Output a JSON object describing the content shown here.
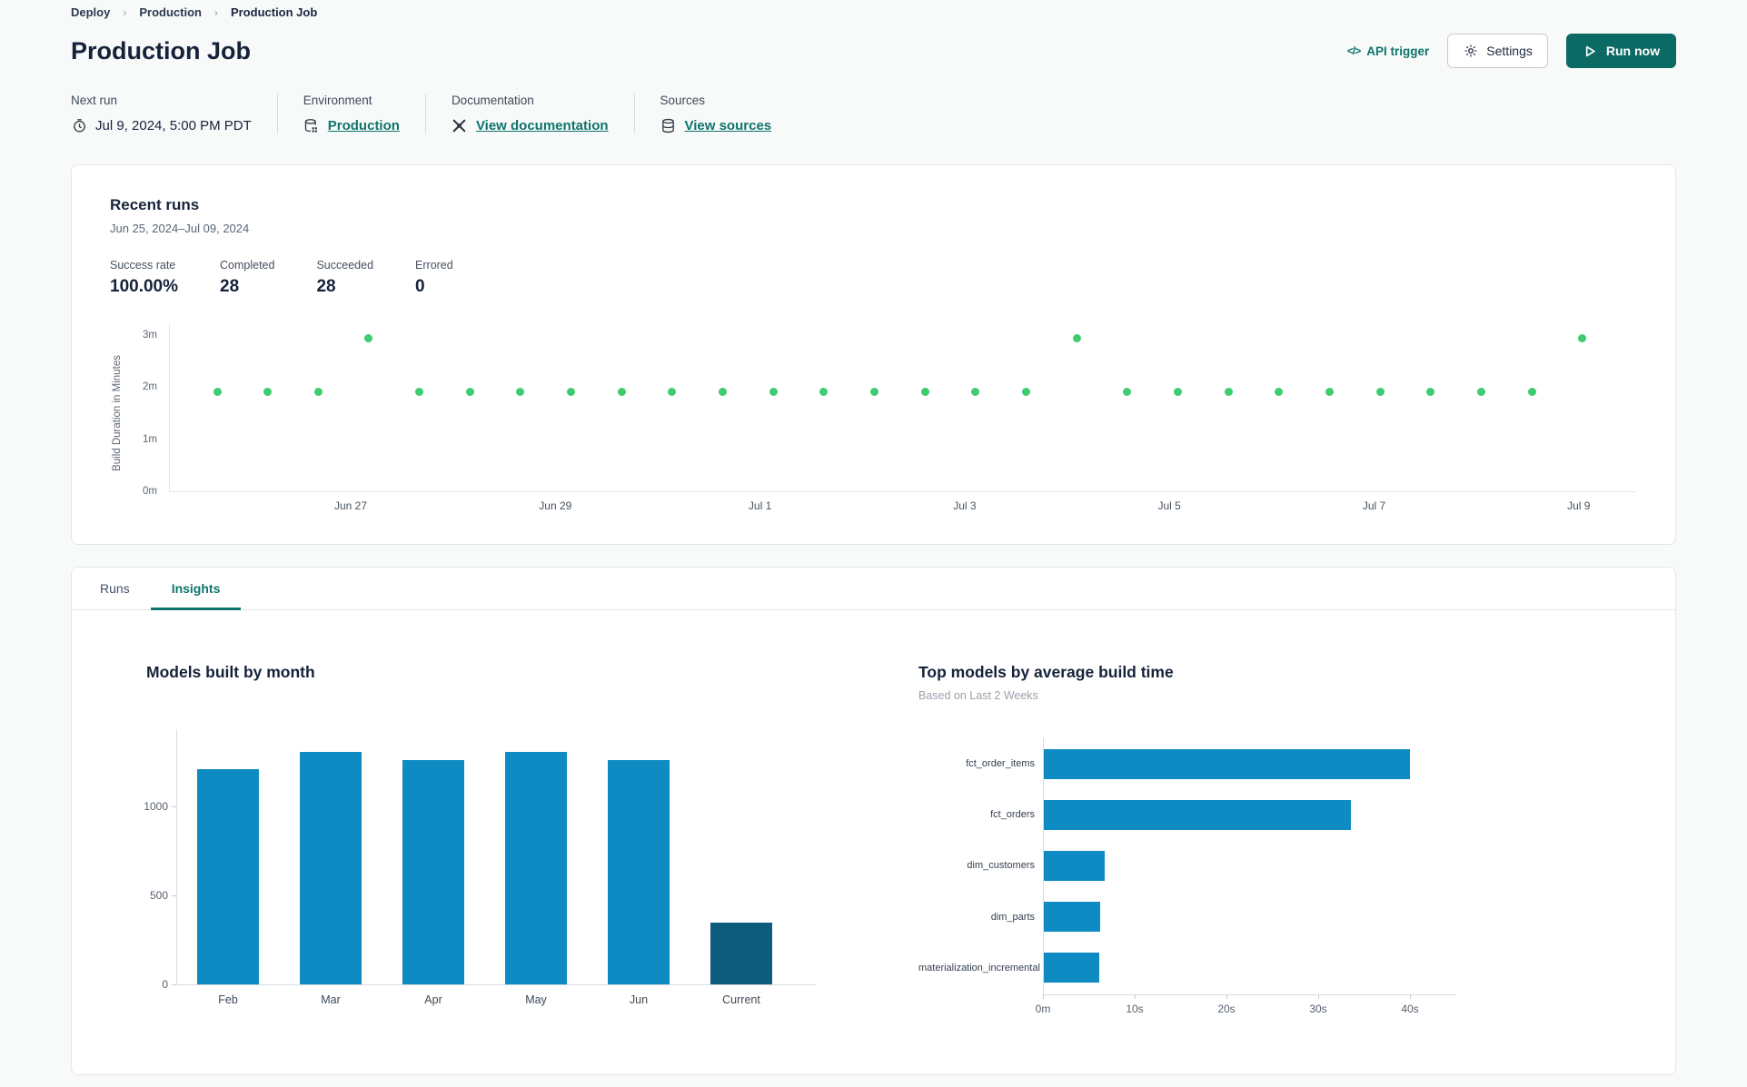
{
  "breadcrumb": {
    "items": [
      "Deploy",
      "Production",
      "Production Job"
    ]
  },
  "header": {
    "title": "Production Job",
    "api_trigger_label": "API trigger",
    "settings_label": "Settings",
    "run_now_label": "Run now"
  },
  "meta": [
    {
      "label": "Next run",
      "value": "Jul 9, 2024, 5:00 PM PDT",
      "icon": "clock-icon",
      "is_link": false
    },
    {
      "label": "Environment",
      "value": "Production",
      "icon": "environment-icon",
      "is_link": true
    },
    {
      "label": "Documentation",
      "value": "View documentation",
      "icon": "dbt-icon",
      "is_link": true
    },
    {
      "label": "Sources",
      "value": "View sources",
      "icon": "database-icon",
      "is_link": true
    }
  ],
  "recent_runs": {
    "title": "Recent runs",
    "date_range": "Jun 25, 2024–Jul 09, 2024",
    "stats": [
      {
        "label": "Success rate",
        "value": "100.00%"
      },
      {
        "label": "Completed",
        "value": "28"
      },
      {
        "label": "Succeeded",
        "value": "28"
      },
      {
        "label": "Errored",
        "value": "0"
      }
    ]
  },
  "tabs": [
    {
      "label": "Runs",
      "active": false
    },
    {
      "label": "Insights",
      "active": true
    }
  ],
  "colors": {
    "accent_teal": "#0D756C",
    "button_teal": "#0B6A63",
    "dot_green": "#3FCB70",
    "bar_blue": "#0E8BC2",
    "bar_dark_teal": "#0D5C7D"
  },
  "chart_data": [
    {
      "type": "scatter",
      "name": "recent-runs-build-duration",
      "ylabel": "Build Duration in Minutes",
      "y_ticks": [
        "0m",
        "1m",
        "2m",
        "3m"
      ],
      "ylim": [
        0,
        3.2
      ],
      "x_tick_labels": [
        "Jun 27",
        "Jun 29",
        "Jul 1",
        "Jul 3",
        "Jul 5",
        "Jul 7",
        "Jul 9"
      ],
      "x_range_dates": [
        "Jun 25, 2024",
        "Jul 09, 2024"
      ],
      "point_color": "#3FCB70",
      "values_minutes": [
        1.93,
        1.93,
        1.93,
        2.95,
        1.93,
        1.93,
        1.93,
        1.93,
        1.93,
        1.93,
        1.93,
        1.93,
        1.93,
        1.93,
        1.93,
        1.93,
        1.93,
        2.95,
        1.93,
        1.93,
        1.93,
        1.93,
        1.93,
        1.93,
        1.93,
        1.93,
        1.93,
        2.95
      ],
      "grid": false,
      "legend": false
    },
    {
      "type": "bar",
      "name": "models-built-by-month",
      "title": "Models built by month",
      "categories": [
        "Feb",
        "Mar",
        "Apr",
        "May",
        "Jun",
        "Current"
      ],
      "values": [
        1210,
        1305,
        1260,
        1305,
        1260,
        345
      ],
      "bar_colors": [
        "#0E8BC2",
        "#0E8BC2",
        "#0E8BC2",
        "#0E8BC2",
        "#0E8BC2",
        "#0D5C7D"
      ],
      "y_ticks": [
        0,
        500,
        1000
      ],
      "ylim": [
        0,
        1430
      ],
      "xlabel": "",
      "ylabel": "",
      "grid": false,
      "legend": false
    },
    {
      "type": "bar-horizontal",
      "name": "top-models-by-average-build-time",
      "title": "Top models by average build time",
      "subtitle": "Based on Last 2 Weeks",
      "categories": [
        "fct_order_items",
        "fct_orders",
        "dim_customers",
        "dim_parts",
        "materialization_incremental"
      ],
      "values_seconds": [
        39.9,
        33.5,
        6.6,
        6.1,
        6.0
      ],
      "bar_color": "#0E8BC2",
      "x_ticks": [
        "0m",
        "10s",
        "20s",
        "30s",
        "40s"
      ],
      "x_tick_seconds": [
        0,
        10,
        20,
        30,
        40
      ],
      "xlim": [
        0,
        45
      ],
      "grid": false,
      "legend": false
    }
  ]
}
